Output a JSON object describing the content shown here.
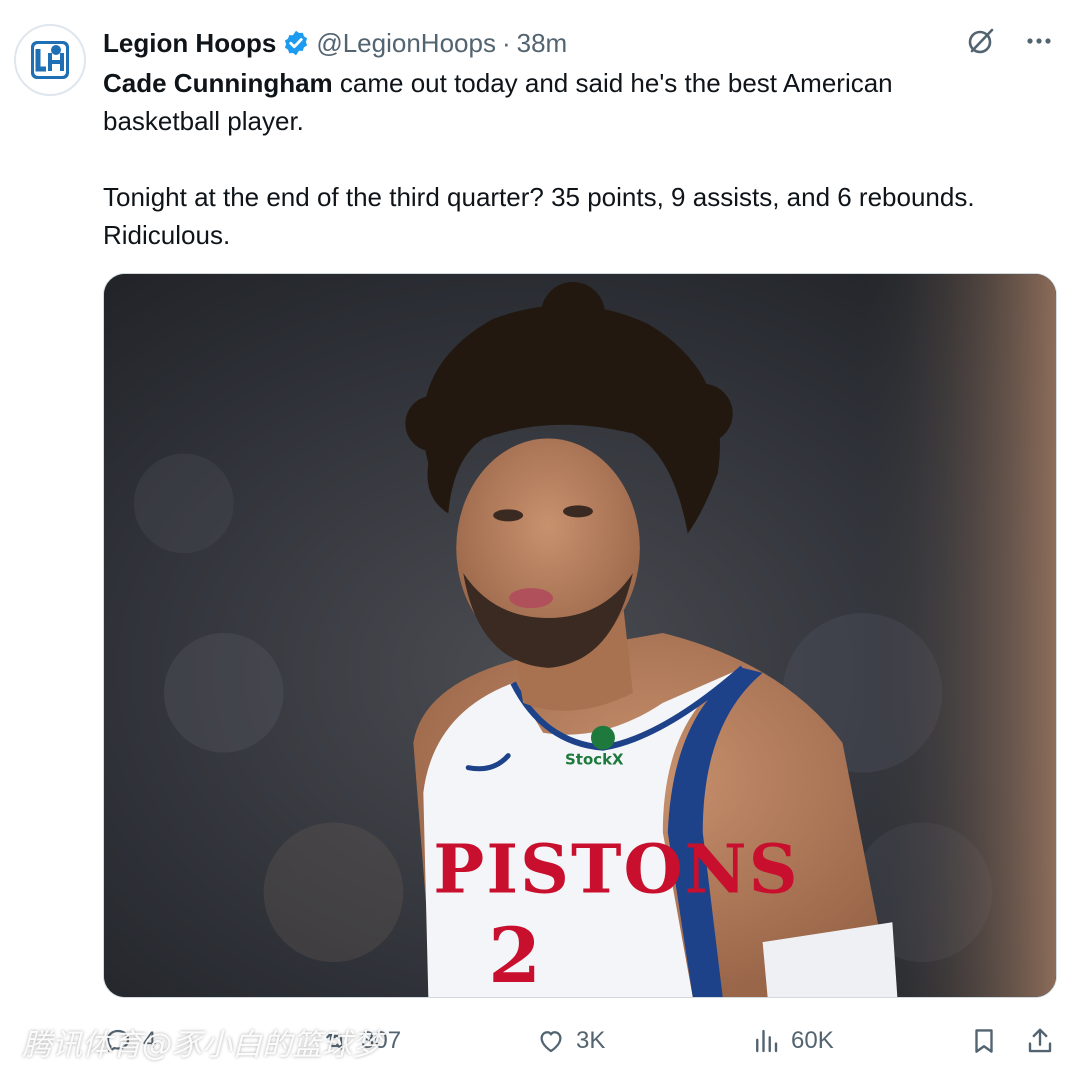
{
  "tweet": {
    "author": {
      "display_name": "Legion Hoops",
      "handle": "@LegionHoops",
      "separator": "·",
      "time": "38m",
      "avatar_text": "LH",
      "verified": true
    },
    "text": {
      "mention": "Cade Cunningham",
      "line1_rest": " came out today and said he's the best American basketball player.",
      "paragraph2": "Tonight at the end of the third quarter? 35 points, 9 assists, and 6 rebounds. Ridiculous."
    },
    "media": {
      "jersey_sponsor": "StockX",
      "jersey_team": "PISTONS",
      "jersey_number": "2"
    },
    "actions": {
      "replies": "4",
      "retweets": "307",
      "likes": "3K",
      "views": "60K"
    },
    "icons": [
      "grok-icon",
      "more-icon",
      "reply-icon",
      "retweet-icon",
      "like-icon",
      "views-icon",
      "bookmark-icon",
      "share-icon"
    ],
    "colors": {
      "accent": "#1d9bf0",
      "text": "#0f1419",
      "muted": "#536471",
      "pistons_red": "#c8102e",
      "pistons_blue": "#1d428a"
    }
  },
  "watermark": "腾讯体育@豕小白的篮球梦"
}
